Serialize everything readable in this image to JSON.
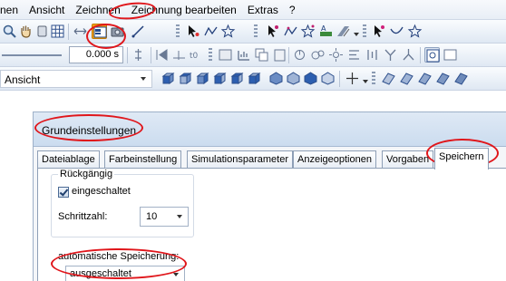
{
  "menubar": {
    "items": [
      "nen",
      "Ansicht",
      "Zeichnen",
      "Zeichnung bearbeiten",
      "Extras",
      "?"
    ]
  },
  "toolbar": {
    "time_value": "0.000 s"
  },
  "viewbar": {
    "label": "Ansicht"
  },
  "dialog": {
    "title": "Grundeinstellungen",
    "tabs": [
      "Dateiablage",
      "Farbeinstellung",
      "Simulationsparameter",
      "Anzeigeoptionen",
      "Vorgaben",
      "Speichern"
    ],
    "active_tab": "Speichern",
    "undo": {
      "caption": "Rückgängig",
      "enabled_label": "eingeschaltet",
      "enabled": true,
      "steps_label": "Schrittzahl:",
      "steps_value": "10"
    },
    "autosave": {
      "label": "automatische Speicherung:",
      "value": "ausgeschaltet"
    }
  },
  "colors": {
    "highlight": "#e0161b",
    "accent_icon": "#f2a20c"
  }
}
